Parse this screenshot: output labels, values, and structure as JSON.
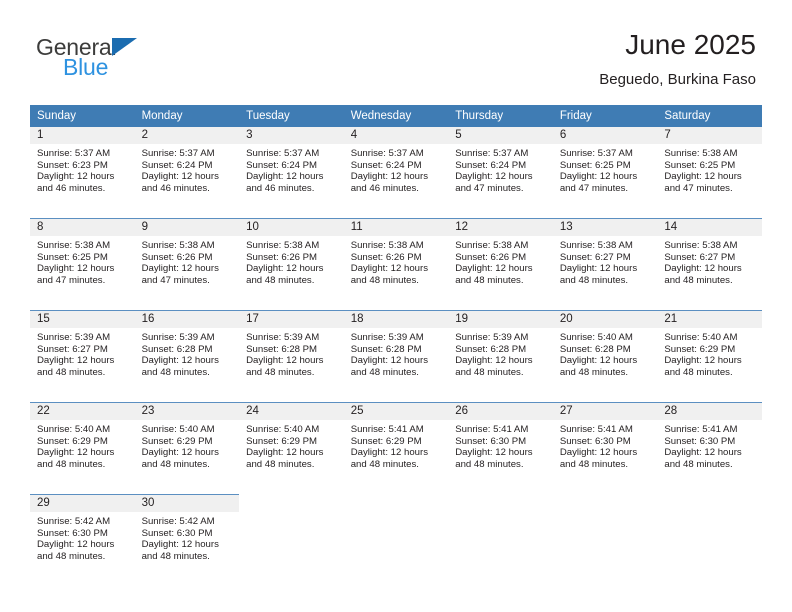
{
  "brand": {
    "name_top": "General",
    "name_bottom": "Blue"
  },
  "header": {
    "title": "June 2025",
    "subtitle": "Beguedo, Burkina Faso"
  },
  "colors": {
    "header_blue": "#3f7cb4",
    "row_line": "#5b8fc1",
    "daynum_band": "#f0f0f0",
    "text": "#231f20",
    "logo_blue": "#2e92e0",
    "logo_triangle": "#1b6cb0"
  },
  "calendar": {
    "weekday_headers": [
      "Sunday",
      "Monday",
      "Tuesday",
      "Wednesday",
      "Thursday",
      "Friday",
      "Saturday"
    ],
    "weeks": [
      [
        {
          "day": "1",
          "sunrise": "Sunrise: 5:37 AM",
          "sunset": "Sunset: 6:23 PM",
          "daylight_1": "Daylight: 12 hours",
          "daylight_2": "and 46 minutes."
        },
        {
          "day": "2",
          "sunrise": "Sunrise: 5:37 AM",
          "sunset": "Sunset: 6:24 PM",
          "daylight_1": "Daylight: 12 hours",
          "daylight_2": "and 46 minutes."
        },
        {
          "day": "3",
          "sunrise": "Sunrise: 5:37 AM",
          "sunset": "Sunset: 6:24 PM",
          "daylight_1": "Daylight: 12 hours",
          "daylight_2": "and 46 minutes."
        },
        {
          "day": "4",
          "sunrise": "Sunrise: 5:37 AM",
          "sunset": "Sunset: 6:24 PM",
          "daylight_1": "Daylight: 12 hours",
          "daylight_2": "and 46 minutes."
        },
        {
          "day": "5",
          "sunrise": "Sunrise: 5:37 AM",
          "sunset": "Sunset: 6:24 PM",
          "daylight_1": "Daylight: 12 hours",
          "daylight_2": "and 47 minutes."
        },
        {
          "day": "6",
          "sunrise": "Sunrise: 5:37 AM",
          "sunset": "Sunset: 6:25 PM",
          "daylight_1": "Daylight: 12 hours",
          "daylight_2": "and 47 minutes."
        },
        {
          "day": "7",
          "sunrise": "Sunrise: 5:38 AM",
          "sunset": "Sunset: 6:25 PM",
          "daylight_1": "Daylight: 12 hours",
          "daylight_2": "and 47 minutes."
        }
      ],
      [
        {
          "day": "8",
          "sunrise": "Sunrise: 5:38 AM",
          "sunset": "Sunset: 6:25 PM",
          "daylight_1": "Daylight: 12 hours",
          "daylight_2": "and 47 minutes."
        },
        {
          "day": "9",
          "sunrise": "Sunrise: 5:38 AM",
          "sunset": "Sunset: 6:26 PM",
          "daylight_1": "Daylight: 12 hours",
          "daylight_2": "and 47 minutes."
        },
        {
          "day": "10",
          "sunrise": "Sunrise: 5:38 AM",
          "sunset": "Sunset: 6:26 PM",
          "daylight_1": "Daylight: 12 hours",
          "daylight_2": "and 48 minutes."
        },
        {
          "day": "11",
          "sunrise": "Sunrise: 5:38 AM",
          "sunset": "Sunset: 6:26 PM",
          "daylight_1": "Daylight: 12 hours",
          "daylight_2": "and 48 minutes."
        },
        {
          "day": "12",
          "sunrise": "Sunrise: 5:38 AM",
          "sunset": "Sunset: 6:26 PM",
          "daylight_1": "Daylight: 12 hours",
          "daylight_2": "and 48 minutes."
        },
        {
          "day": "13",
          "sunrise": "Sunrise: 5:38 AM",
          "sunset": "Sunset: 6:27 PM",
          "daylight_1": "Daylight: 12 hours",
          "daylight_2": "and 48 minutes."
        },
        {
          "day": "14",
          "sunrise": "Sunrise: 5:38 AM",
          "sunset": "Sunset: 6:27 PM",
          "daylight_1": "Daylight: 12 hours",
          "daylight_2": "and 48 minutes."
        }
      ],
      [
        {
          "day": "15",
          "sunrise": "Sunrise: 5:39 AM",
          "sunset": "Sunset: 6:27 PM",
          "daylight_1": "Daylight: 12 hours",
          "daylight_2": "and 48 minutes."
        },
        {
          "day": "16",
          "sunrise": "Sunrise: 5:39 AM",
          "sunset": "Sunset: 6:28 PM",
          "daylight_1": "Daylight: 12 hours",
          "daylight_2": "and 48 minutes."
        },
        {
          "day": "17",
          "sunrise": "Sunrise: 5:39 AM",
          "sunset": "Sunset: 6:28 PM",
          "daylight_1": "Daylight: 12 hours",
          "daylight_2": "and 48 minutes."
        },
        {
          "day": "18",
          "sunrise": "Sunrise: 5:39 AM",
          "sunset": "Sunset: 6:28 PM",
          "daylight_1": "Daylight: 12 hours",
          "daylight_2": "and 48 minutes."
        },
        {
          "day": "19",
          "sunrise": "Sunrise: 5:39 AM",
          "sunset": "Sunset: 6:28 PM",
          "daylight_1": "Daylight: 12 hours",
          "daylight_2": "and 48 minutes."
        },
        {
          "day": "20",
          "sunrise": "Sunrise: 5:40 AM",
          "sunset": "Sunset: 6:28 PM",
          "daylight_1": "Daylight: 12 hours",
          "daylight_2": "and 48 minutes."
        },
        {
          "day": "21",
          "sunrise": "Sunrise: 5:40 AM",
          "sunset": "Sunset: 6:29 PM",
          "daylight_1": "Daylight: 12 hours",
          "daylight_2": "and 48 minutes."
        }
      ],
      [
        {
          "day": "22",
          "sunrise": "Sunrise: 5:40 AM",
          "sunset": "Sunset: 6:29 PM",
          "daylight_1": "Daylight: 12 hours",
          "daylight_2": "and 48 minutes."
        },
        {
          "day": "23",
          "sunrise": "Sunrise: 5:40 AM",
          "sunset": "Sunset: 6:29 PM",
          "daylight_1": "Daylight: 12 hours",
          "daylight_2": "and 48 minutes."
        },
        {
          "day": "24",
          "sunrise": "Sunrise: 5:40 AM",
          "sunset": "Sunset: 6:29 PM",
          "daylight_1": "Daylight: 12 hours",
          "daylight_2": "and 48 minutes."
        },
        {
          "day": "25",
          "sunrise": "Sunrise: 5:41 AM",
          "sunset": "Sunset: 6:29 PM",
          "daylight_1": "Daylight: 12 hours",
          "daylight_2": "and 48 minutes."
        },
        {
          "day": "26",
          "sunrise": "Sunrise: 5:41 AM",
          "sunset": "Sunset: 6:30 PM",
          "daylight_1": "Daylight: 12 hours",
          "daylight_2": "and 48 minutes."
        },
        {
          "day": "27",
          "sunrise": "Sunrise: 5:41 AM",
          "sunset": "Sunset: 6:30 PM",
          "daylight_1": "Daylight: 12 hours",
          "daylight_2": "and 48 minutes."
        },
        {
          "day": "28",
          "sunrise": "Sunrise: 5:41 AM",
          "sunset": "Sunset: 6:30 PM",
          "daylight_1": "Daylight: 12 hours",
          "daylight_2": "and 48 minutes."
        }
      ],
      [
        {
          "day": "29",
          "sunrise": "Sunrise: 5:42 AM",
          "sunset": "Sunset: 6:30 PM",
          "daylight_1": "Daylight: 12 hours",
          "daylight_2": "and 48 minutes."
        },
        {
          "day": "30",
          "sunrise": "Sunrise: 5:42 AM",
          "sunset": "Sunset: 6:30 PM",
          "daylight_1": "Daylight: 12 hours",
          "daylight_2": "and 48 minutes."
        },
        {
          "day": "",
          "sunrise": "",
          "sunset": "",
          "daylight_1": "",
          "daylight_2": ""
        },
        {
          "day": "",
          "sunrise": "",
          "sunset": "",
          "daylight_1": "",
          "daylight_2": ""
        },
        {
          "day": "",
          "sunrise": "",
          "sunset": "",
          "daylight_1": "",
          "daylight_2": ""
        },
        {
          "day": "",
          "sunrise": "",
          "sunset": "",
          "daylight_1": "",
          "daylight_2": ""
        },
        {
          "day": "",
          "sunrise": "",
          "sunset": "",
          "daylight_1": "",
          "daylight_2": ""
        }
      ]
    ]
  }
}
